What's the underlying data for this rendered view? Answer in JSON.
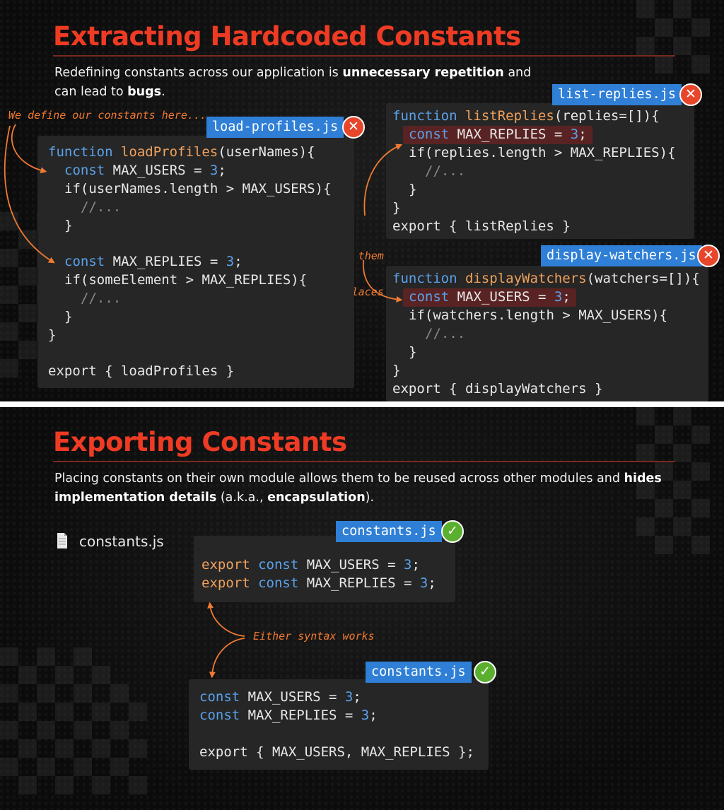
{
  "section1": {
    "title": "Extracting Hardcoded Constants",
    "desc_line1_a": "Redefining constants across our application is ",
    "desc_line1_b": "unnecessary repetition",
    "desc_line1_c": " and",
    "desc_line2_a": "can lead to ",
    "desc_line2_b": "bugs",
    "desc_line2_c": ".",
    "note_define": "We define our constants here...",
    "note_again_1": "...and then we define them",
    "note_again_2": "again on different places",
    "load_profiles": {
      "filename": "load-profiles.js",
      "status": "✕",
      "lines": [
        {
          "k1": "function",
          "f": "loadProfiles",
          "r": "(userNames){"
        },
        {
          "k1": "const",
          "r": " MAX_USERS = ",
          "n": "3",
          "e": ";"
        },
        {
          "r": "if(userNames.length > MAX_USERS){"
        },
        {
          "c": "//..."
        },
        {
          "r": "}"
        },
        {
          "k1": "const",
          "r": " MAX_REPLIES = ",
          "n": "3",
          "e": ";"
        },
        {
          "r": "if(someElement > MAX_REPLIES){"
        },
        {
          "c": "//..."
        },
        {
          "r": "}"
        },
        {
          "r": "}"
        },
        {
          "r": "export { loadProfiles }"
        }
      ]
    },
    "list_replies": {
      "filename": "list-replies.js",
      "status": "✕",
      "lines": [
        {
          "k1": "function",
          "f": "listReplies",
          "r": "(replies=[]){"
        },
        {
          "k1": "const",
          "r": " MAX_REPLIES = ",
          "n": "3",
          "e": ";"
        },
        {
          "r": "if(replies.length > MAX_REPLIES){"
        },
        {
          "c": "//..."
        },
        {
          "r": "}"
        },
        {
          "r": "}"
        },
        {
          "r": "export { listReplies }"
        }
      ]
    },
    "display_watchers": {
      "filename": "display-watchers.js",
      "status": "✕",
      "lines": [
        {
          "k1": "function",
          "f": "displayWatchers",
          "r": "(watchers=[]){"
        },
        {
          "k1": "const",
          "r": " MAX_USERS = ",
          "n": "3",
          "e": ";"
        },
        {
          "r": "if(watchers.length > MAX_USERS){"
        },
        {
          "c": "//..."
        },
        {
          "r": "}"
        },
        {
          "r": "}"
        },
        {
          "r": "export { displayWatchers }"
        }
      ]
    }
  },
  "section2": {
    "title": "Exporting Constants",
    "desc_line1_a": "Placing constants on their own module allows them to be reused across other modules and ",
    "desc_line1_b": "hides",
    "desc_line2_a": "implementation details",
    "desc_line2_b": " (a.k.a., ",
    "desc_line2_c": "encapsulation",
    "desc_line2_d": ").",
    "file_label": "constants.js",
    "note_either": "Either syntax works",
    "constants_a": {
      "filename": "constants.js",
      "status": "✓",
      "lines": [
        {
          "e1": "export",
          "k1": "const",
          "r": " MAX_USERS = ",
          "n": "3",
          "e": ";"
        },
        {
          "e1": "export",
          "k1": "const",
          "r": " MAX_REPLIES = ",
          "n": "3",
          "e": ";"
        }
      ]
    },
    "constants_b": {
      "filename": "constants.js",
      "status": "✓",
      "lines": [
        {
          "k1": "const",
          "r": " MAX_USERS = ",
          "n": "3",
          "e": ";"
        },
        {
          "k1": "const",
          "r": " MAX_REPLIES = ",
          "n": "3",
          "e": ";"
        },
        {
          "r": "export { MAX_USERS, MAX_REPLIES };"
        }
      ]
    }
  },
  "colors": {
    "title": "#ef3b24",
    "keyword": "#5aa2ec",
    "function": "#f0a15c",
    "tag": "#2f7fd6",
    "bad": "#e8462a",
    "good": "#5ab02e",
    "annotation": "#f07a32"
  },
  "icons": {
    "bad": "x-circle-icon",
    "good": "check-circle-icon",
    "file": "file-icon"
  }
}
